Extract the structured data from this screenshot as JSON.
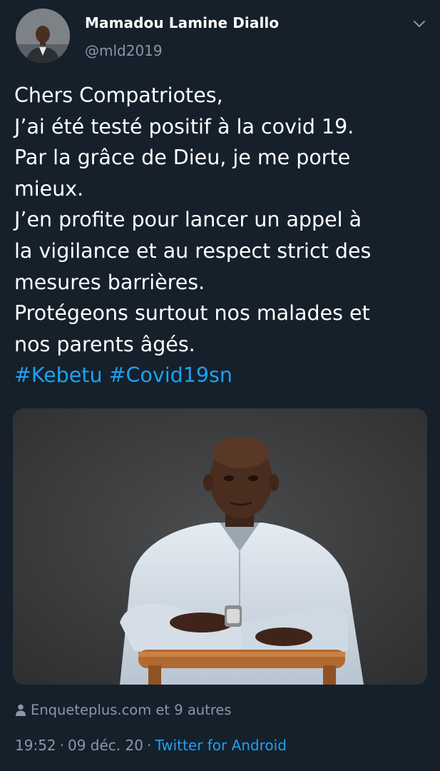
{
  "author": {
    "name": "Mamadou Lamine Diallo",
    "handle": "@mld2019"
  },
  "tweet": {
    "lines": [
      "Chers Compatriotes,",
      "J’ai été testé positif à la covid 19.",
      "Par la grâce de Dieu, je me porte",
      "mieux.",
      "J’en profite pour lancer un appel à",
      "la vigilance et au respect strict des",
      "mesures barrières.",
      "Protégeons surtout nos malades et",
      "nos parents âgés."
    ],
    "hashtags": [
      "#Kebetu",
      "#Covid19sn"
    ]
  },
  "engagement": {
    "likes_text": "Enqueteplus.com et 9 autres"
  },
  "meta": {
    "time": "19:52",
    "separator": "·",
    "date": "09 déc. 20",
    "source": "Twitter for Android"
  },
  "icons": {
    "menu": "chevron-down-icon",
    "likes": "person-icon"
  },
  "colors": {
    "background": "#15202b",
    "text": "#ffffff",
    "secondary": "#8899a6",
    "accent": "#1da1f2"
  }
}
